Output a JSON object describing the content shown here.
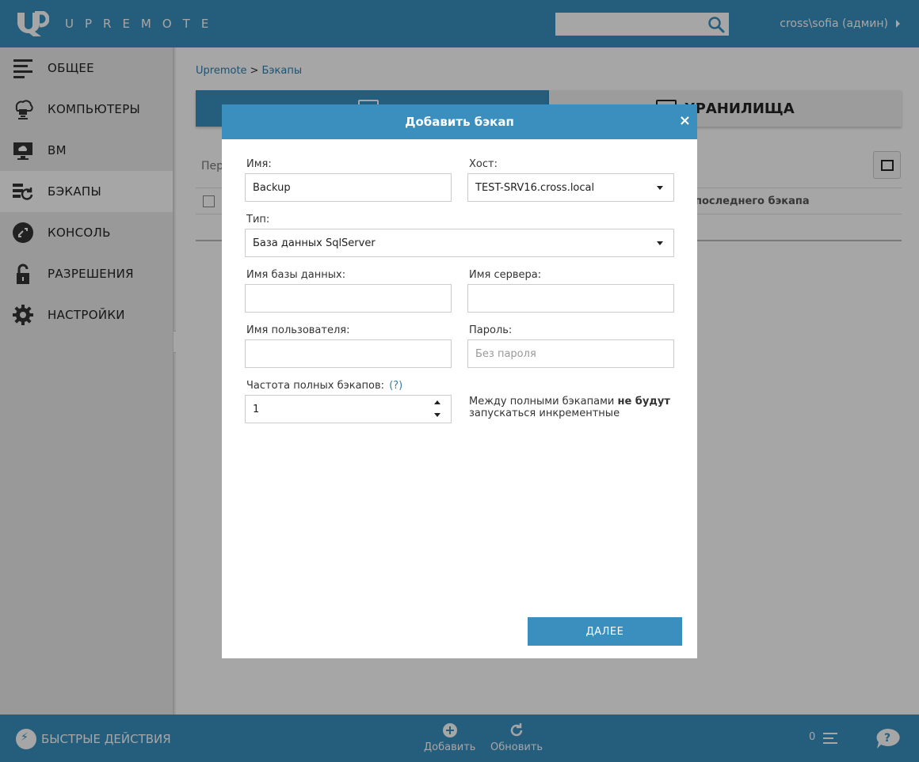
{
  "app": {
    "name": "UPREMOTE",
    "user": "cross\\sofia (админ)",
    "search_placeholder": ""
  },
  "sidebar": {
    "items": [
      {
        "label": "ОБЩЕЕ",
        "icon": "list-icon"
      },
      {
        "label": "КОМПЬЮТЕРЫ",
        "icon": "computers-cloud-icon"
      },
      {
        "label": "ВМ",
        "icon": "monitor-cloud-icon"
      },
      {
        "label": "БЭКАПЫ",
        "icon": "backup-icon",
        "active": true
      },
      {
        "label": "КОНСОЛЬ",
        "icon": "console-icon"
      },
      {
        "label": "РАЗРЕШЕНИЯ",
        "icon": "lock-open-icon"
      },
      {
        "label": "НАСТРОЙКИ",
        "icon": "gear-icon"
      }
    ]
  },
  "breadcrumb": {
    "root": "Upremote",
    "sep": ">",
    "current": "Бэкапы"
  },
  "tabs": [
    {
      "label": "",
      "active": true
    },
    {
      "label": "ХРАНИЛИЩА",
      "active": false
    }
  ],
  "list": {
    "filter_label": "Пер",
    "col_last_backup": "последнего бэкапа"
  },
  "bottombar": {
    "quick_actions": "БЫСТРЫЕ ДЕЙСТВИЯ",
    "add": "Добавить",
    "refresh": "Обновить",
    "count": "0"
  },
  "modal": {
    "title": "Добавить бэкап",
    "close": "×",
    "name_label": "Имя:",
    "name_value": "Backup",
    "host_label": "Хост:",
    "host_value": "TEST-SRV16.cross.local",
    "type_label": "Тип:",
    "type_value": "База данных SqlServer",
    "db_name_label": "Имя базы данных:",
    "db_name_value": "",
    "server_name_label": "Имя сервера:",
    "server_name_value": "",
    "user_label": "Имя пользователя:",
    "user_value": "",
    "password_label": "Пароль:",
    "password_placeholder": "Без пароля",
    "freq_label": "Частота полных бэкапов:",
    "freq_hint": "(?)",
    "freq_value": "1",
    "note_prefix": "Между полными бэкапами ",
    "note_bold": "не будут",
    "note_suffix": " запускаться инкрементные",
    "next_button": "ДАЛЕЕ"
  },
  "colors": {
    "brand": "#3a8fbf",
    "link": "#2f7fae"
  }
}
